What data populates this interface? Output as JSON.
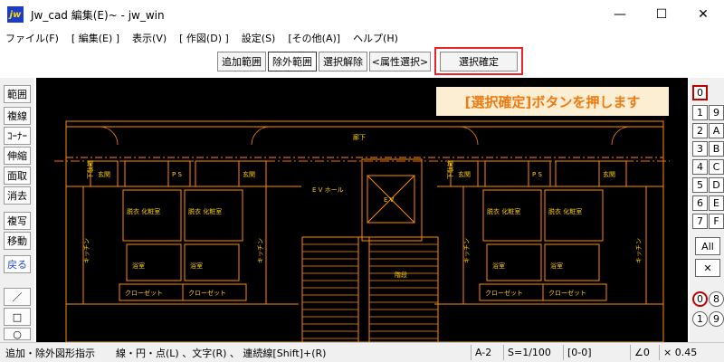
{
  "window": {
    "icon_text": "jw",
    "title": "Jw_cad 編集(E)~ - jw_win",
    "minimize": "—",
    "maximize": "☐",
    "close": "✕"
  },
  "menu": [
    "ファイル(F)",
    "[ 編集(E) ]",
    "表示(V)",
    "[ 作図(D) ]",
    "設定(S)",
    "[その他(A)]",
    "ヘルプ(H)"
  ],
  "toolbar": {
    "add_range": "追加範囲",
    "exclude_range": "除外範囲",
    "cancel_selection": "選択解除",
    "attribute_select": "<属性選択>",
    "confirm_selection": "選択確定"
  },
  "annotation": "[選択確定]ボタンを押します",
  "left_tools": [
    "範囲",
    "複線",
    "ｺｰﾅｰ",
    "伸縮",
    "面取",
    "消去",
    "複写",
    "移動",
    "戻る",
    "／",
    "□",
    "○"
  ],
  "right_tools": {
    "layer_top": "0",
    "layers": [
      "1",
      "2",
      "3",
      "4",
      "5",
      "6",
      "7"
    ],
    "groups": [
      "9",
      "A",
      "B",
      "C",
      "D",
      "E",
      "F"
    ],
    "all": "All",
    "cross": "✕",
    "circled_row1": [
      "0",
      "8"
    ],
    "circled_row2": [
      "1",
      "9"
    ]
  },
  "plan_labels": {
    "corridor": "廊下",
    "entrance": "玄関",
    "ps": "P S",
    "ev_hall": "E V\nホール",
    "ev": "E V",
    "dressing": "脱衣\n化粧室",
    "kitchen": "キッチン",
    "bath": "浴室",
    "closet": "クローゼット",
    "stairs": "階段",
    "shoe": "下駄箱"
  },
  "status": {
    "hint": "追加・除外図形指示",
    "shortcut": "線・円・点(L) 、文字(R) 、 連続線[Shift]+(R)",
    "paper": "A-2",
    "scale": "S=1/100",
    "layer": "[0-0]",
    "angle": "∠0",
    "zoom": "× 0.45"
  },
  "colors": {
    "accent_red": "#e8242c",
    "annotation_text": "#f07a10",
    "annotation_bg": "#fbeed2",
    "plan_line": "#ff8c00",
    "plan_text": "#ffd000"
  }
}
